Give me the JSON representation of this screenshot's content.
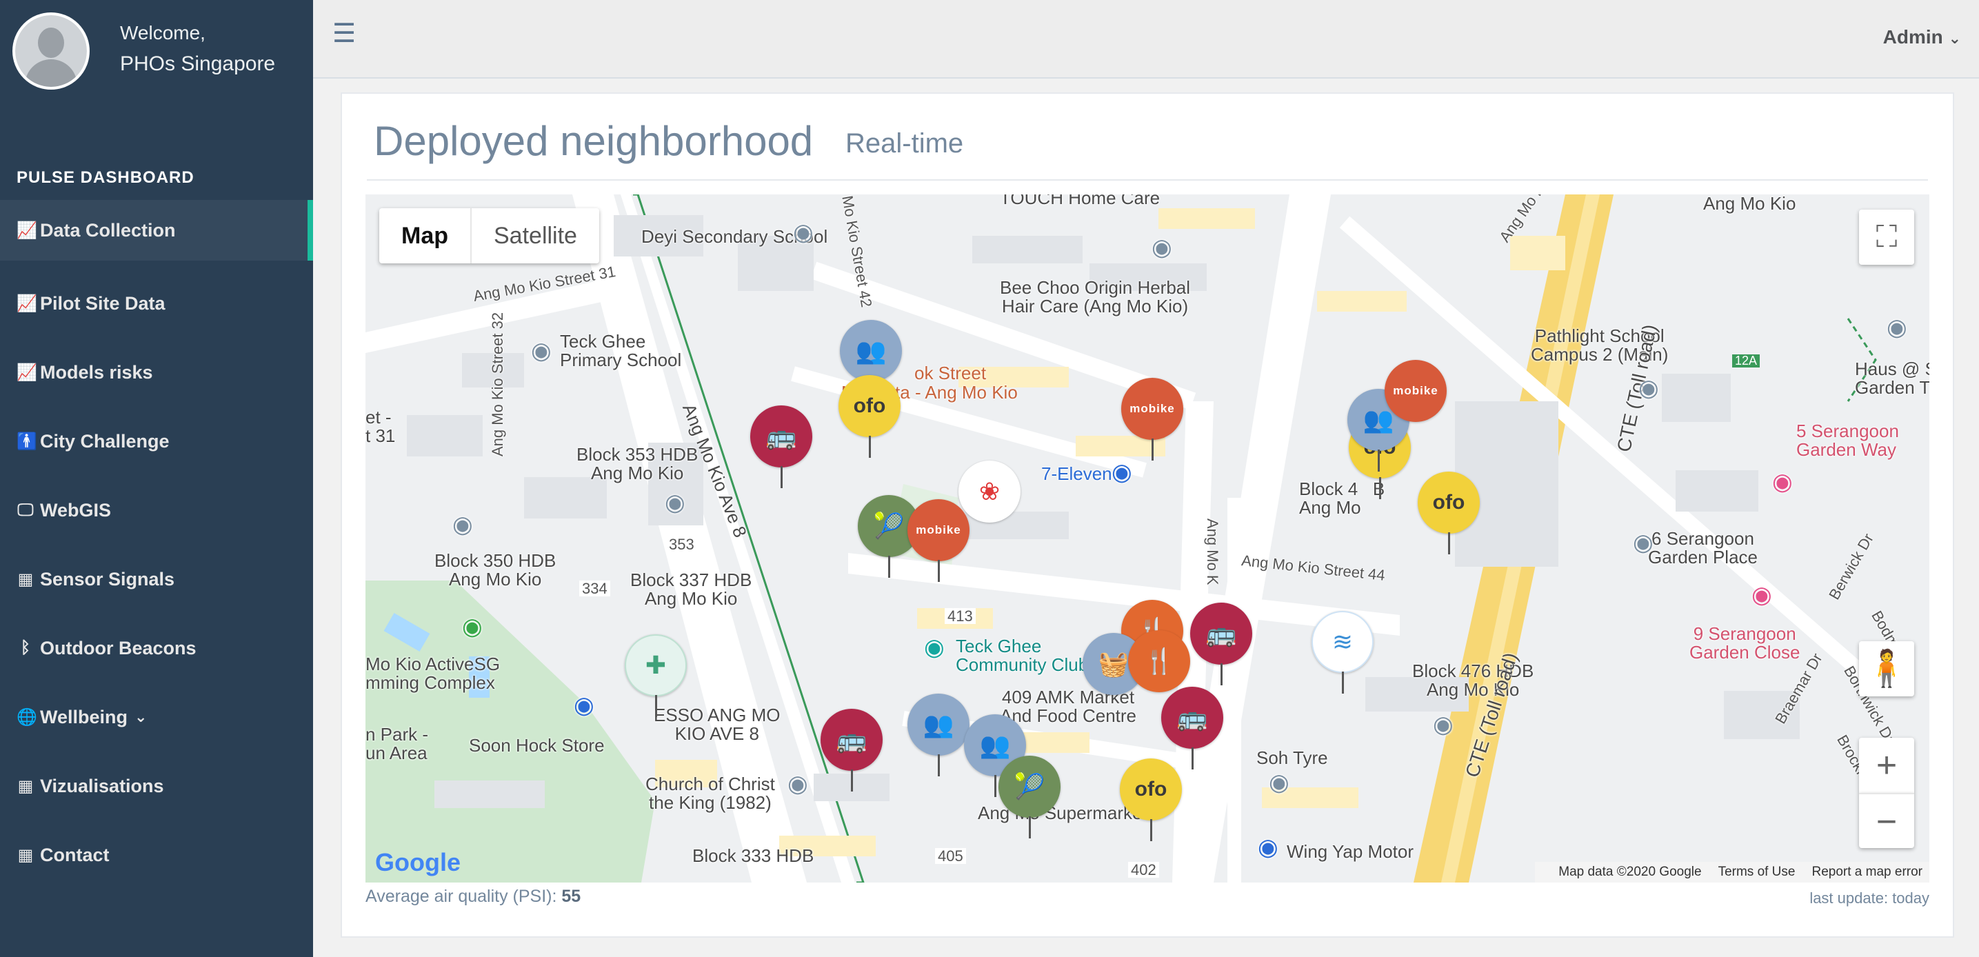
{
  "profile": {
    "welcome": "Welcome,",
    "name": "PHOs Singapore"
  },
  "sidebar": {
    "section_title": "PULSE DASHBOARD",
    "items": [
      {
        "label": "Data Collection",
        "icon": "chart-icon",
        "active": true
      },
      {
        "label": "Pilot Site Data",
        "icon": "chart-icon"
      },
      {
        "label": "Models risks",
        "icon": "chart-icon"
      },
      {
        "label": "City Challenge",
        "icon": "person-icon"
      },
      {
        "label": "WebGIS",
        "icon": "desktop-icon"
      },
      {
        "label": "Sensor Signals",
        "icon": "table-icon"
      },
      {
        "label": "Outdoor Beacons",
        "icon": "bluetooth-icon"
      },
      {
        "label": "Wellbeing",
        "icon": "globe-icon",
        "dropdown": true
      },
      {
        "label": "Vizualisations",
        "icon": "table-icon"
      },
      {
        "label": "Contact",
        "icon": "table-icon"
      }
    ]
  },
  "topbar": {
    "user_menu": "Admin"
  },
  "panel": {
    "title": "Deployed neighborhood",
    "subtitle": "Real-time"
  },
  "map": {
    "type_buttons": [
      "Map",
      "Satellite"
    ],
    "labels": {
      "deyi": "Deyi Secondary School",
      "toh": "TOUCH Home Care",
      "amk_top": "Ang Mo Kio",
      "bee_choo": "Bee Choo Origin Herbal\nHair Care (Ang Mo Kio)",
      "amk_st31": "Ang Mo Kio Street 31",
      "amk_st42": "Mo Kio Street 42",
      "amk_st32": "Ang Mo Kio Street 32",
      "teck_ghee_pri": "Teck Ghee\nPrimary School",
      "kovan_st": "ok Street",
      "mookata": "Mookata - Ang Mo Kio",
      "pathlight": "Pathlight School\nCampus 2 (Main)",
      "haus": "Haus @ S\nGarden T",
      "serangoon5": "5 Serangoon\nGarden Way",
      "block353": "Block 353 HDB\nAng Mo Kio",
      "amk_ave8": "Ang Mo Kio Ave 8",
      "seven_eleven": "7-Eleven",
      "block4": "Block 4   B\nAng Mo",
      "block350": "Block 350 HDB\nAng Mo Kio",
      "block337": "Block 337 HDB\nAng Mo Kio",
      "amk_st44": "Ang Mo Kio Street 44",
      "serangoon6": "6 Serangoon\nGarden Place",
      "serangoon9": "9 Serangoon\nGarden Close",
      "activesg": "Mo Kio ActiveSG\nmming Complex",
      "teck_ghee_cc": "Teck Ghee\nCommunity Club",
      "market409": "409 AMK Market\nAnd Food Centre",
      "block476": "Block 476 HDB\nAng Mo Kio",
      "esso": "ESSO ANG MO\nKIO AVE 8",
      "soon_hock": "Soon Hock Store",
      "park": "n Park -\nun Area",
      "church": "Church of Christ\nthe King (1982)",
      "soh_tyre": "Soh Tyre",
      "supermarket": "Ang Mo Supermarket",
      "wing_yap": "Wing Yap Motor",
      "block333": "Block 333 HDB",
      "cte": "CTE (Toll road)",
      "berwick": "Berwick Dr",
      "braemar": "Braemar Dr",
      "brockhampton": "Brockhampton Dr",
      "bodmin": "Bodmi",
      "borthwick": "Borthwick Dr",
      "street31": "et -\nt 31",
      "amk_side": "Ang Mo Kio",
      "exit12a": "12A",
      "b353": "353",
      "b334": "334",
      "b413": "413",
      "b405": "405",
      "b402": "402",
      "ang_mo_k": "Ang Mo K"
    },
    "markers": {
      "ofo": "ofo",
      "mobike": "mobike"
    },
    "footer": [
      "Map data ©2020 Google",
      "Terms of Use",
      "Report a map error"
    ],
    "logo": "Google"
  },
  "status": {
    "psi_label": "Average air quality (PSI):",
    "psi_value": "55",
    "last_update": "last update: today"
  },
  "colors": {
    "sidebar": "#2a3f54",
    "accent": "#1abb9c",
    "bus": "#b0284a",
    "ofo": "#f2d13b",
    "mobike": "#d75a3a",
    "people": "#8fa9c9",
    "sport": "#6f8f5a",
    "food": "#e2682f",
    "health": "#e5f3ee"
  }
}
